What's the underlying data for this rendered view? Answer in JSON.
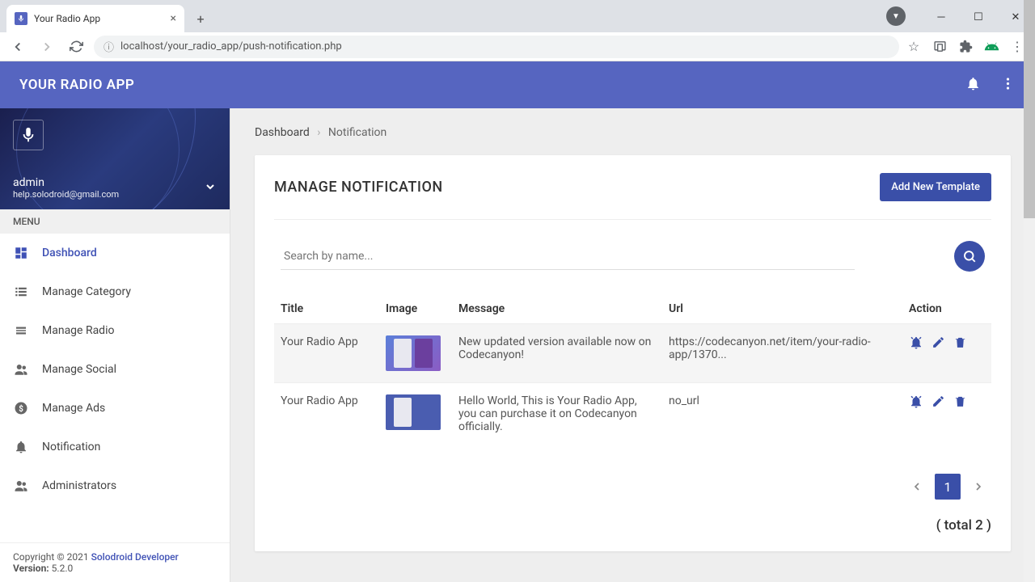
{
  "browser": {
    "tab_title": "Your Radio App",
    "url": "localhost/your_radio_app/push-notification.php"
  },
  "header": {
    "title": "YOUR RADIO APP"
  },
  "sidebar": {
    "user": {
      "name": "admin",
      "email": "help.solodroid@gmail.com"
    },
    "menu_label": "MENU",
    "items": [
      {
        "label": "Dashboard"
      },
      {
        "label": "Manage Category"
      },
      {
        "label": "Manage Radio"
      },
      {
        "label": "Manage Social"
      },
      {
        "label": "Manage Ads"
      },
      {
        "label": "Notification"
      },
      {
        "label": "Administrators"
      }
    ],
    "footer": {
      "copyright": "Copyright © 2021 ",
      "developer": "Solodroid Developer",
      "version_label": "Version:",
      "version": "5.2.0"
    }
  },
  "main": {
    "breadcrumb": {
      "root": "Dashboard",
      "current": "Notification"
    },
    "card_title": "MANAGE NOTIFICATION",
    "add_button": "Add New Template",
    "search_placeholder": "Search by name...",
    "columns": {
      "title": "Title",
      "image": "Image",
      "message": "Message",
      "url": "Url",
      "action": "Action"
    },
    "rows": [
      {
        "title": "Your Radio App",
        "message": "New updated version available now on Codecanyon!",
        "url": "https://codecanyon.net/item/your-radio-app/1370..."
      },
      {
        "title": "Your Radio App",
        "message": "Hello World, This is Your Radio App, you can purchase it on Codecanyon officially.",
        "url": "no_url"
      }
    ],
    "pagination": {
      "current": "1",
      "total_text": "( total 2 )"
    }
  }
}
